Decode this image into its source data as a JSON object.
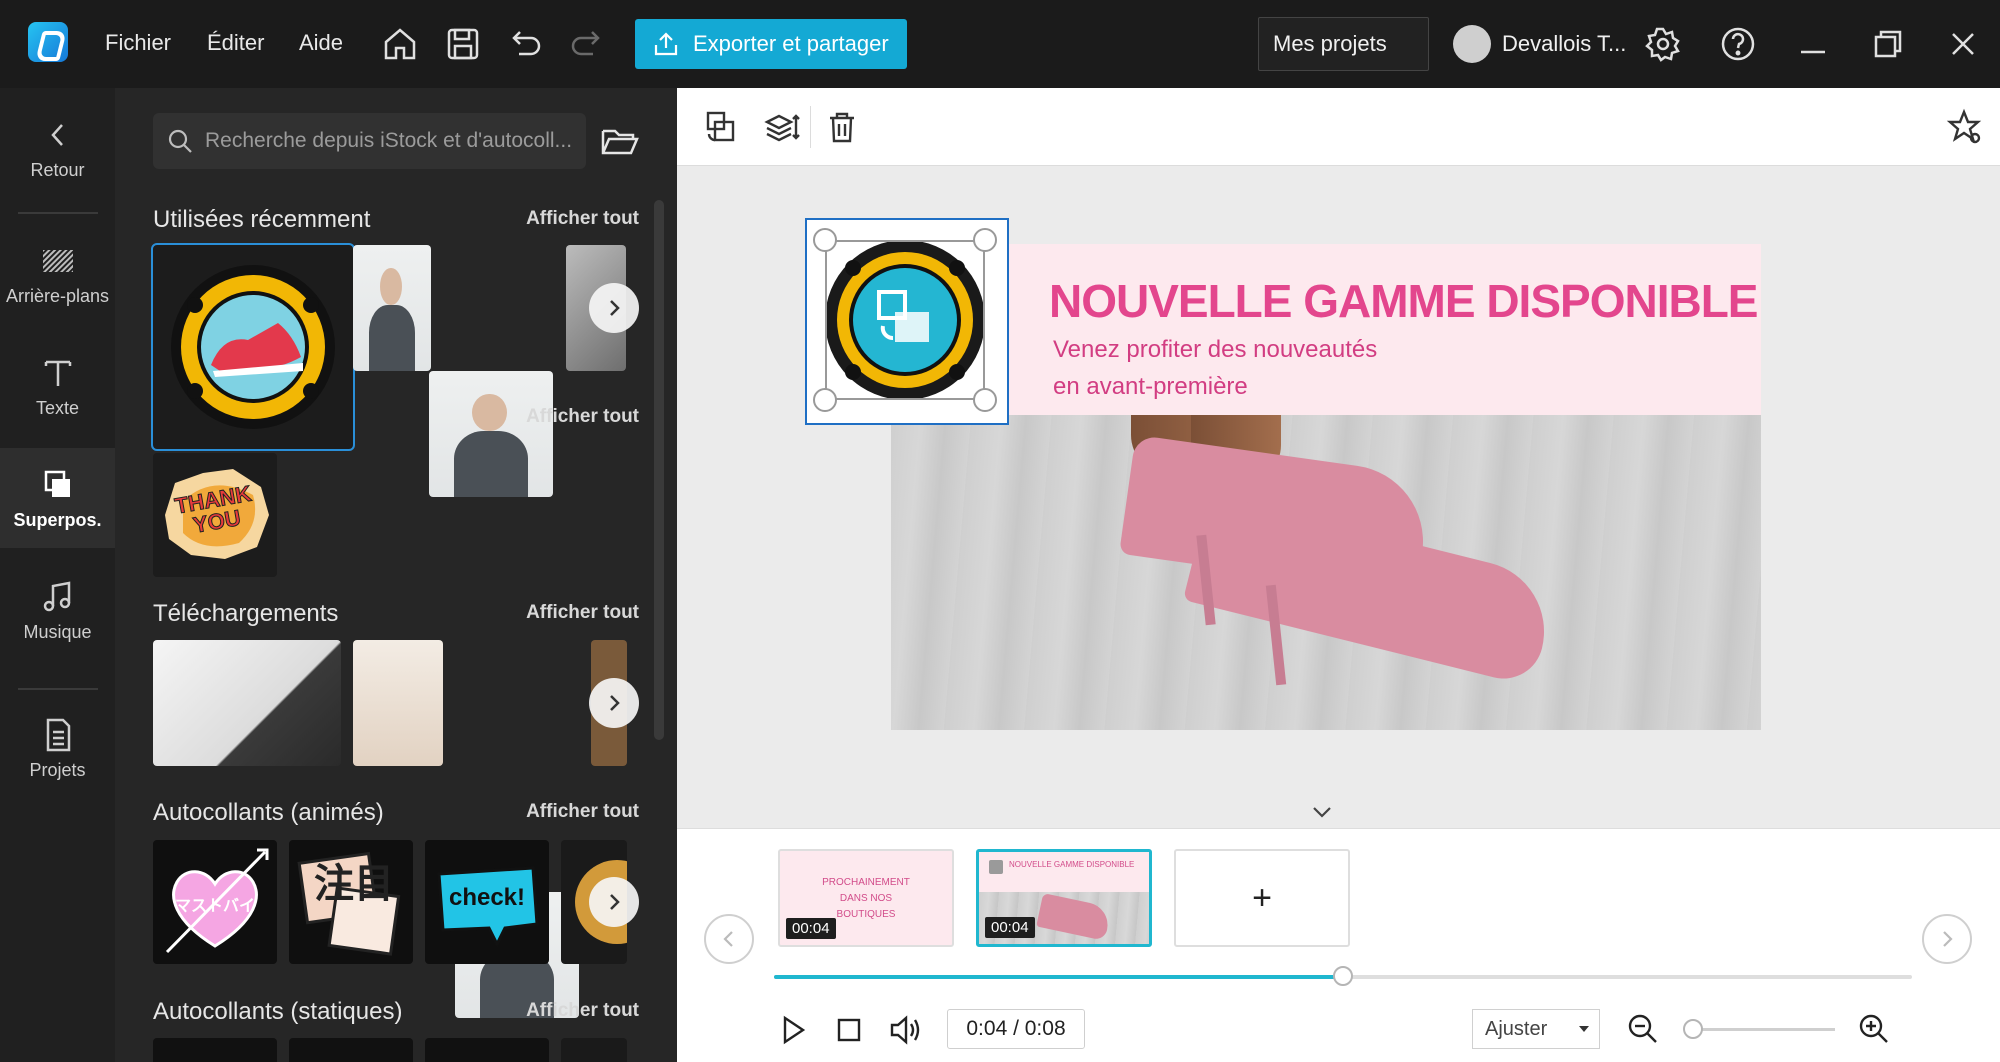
{
  "menu": {
    "file": "Fichier",
    "edit": "Éditer",
    "help": "Aide"
  },
  "export_label": "Exporter et partager",
  "projects_label": "Mes projets",
  "user_name": "Devallois T...",
  "nav": {
    "back": "Retour",
    "backgrounds": "Arrière-plans",
    "text": "Texte",
    "overlays": "Superpos.",
    "music": "Musique",
    "projects": "Projets"
  },
  "search_placeholder": "Recherche depuis iStock et d'autocoll...",
  "sections": {
    "recent": "Utilisées récemment",
    "downloads": "Téléchargements",
    "animated": "Autocollants (animés)",
    "static": "Autocollants (statiques)",
    "see_all": "Afficher tout"
  },
  "stickers": {
    "thank_you": "THANK YOU",
    "check": "check!",
    "heart_text": "マストバイ",
    "attention": "注目"
  },
  "slide": {
    "title": "NOUVELLE GAMME DISPONIBLE",
    "subtitle_line1": "Venez profiter des nouveautés",
    "subtitle_line2": "en avant-première"
  },
  "clips": [
    {
      "text": "PROCHAINEMENT DANS NOS BOUTIQUES",
      "time": "00:04"
    },
    {
      "text": "NOUVELLE GAMME DISPONIBLE",
      "time": "00:04"
    }
  ],
  "add_clip": "+",
  "playback": {
    "time": "0:04 / 0:08",
    "progress": 0.5
  },
  "zoom": {
    "fit_label": "Ajuster",
    "level": 0.0
  },
  "colors": {
    "accent": "#14a9d4",
    "slide_pink": "#e3468d",
    "banner": "#fde9ee"
  }
}
